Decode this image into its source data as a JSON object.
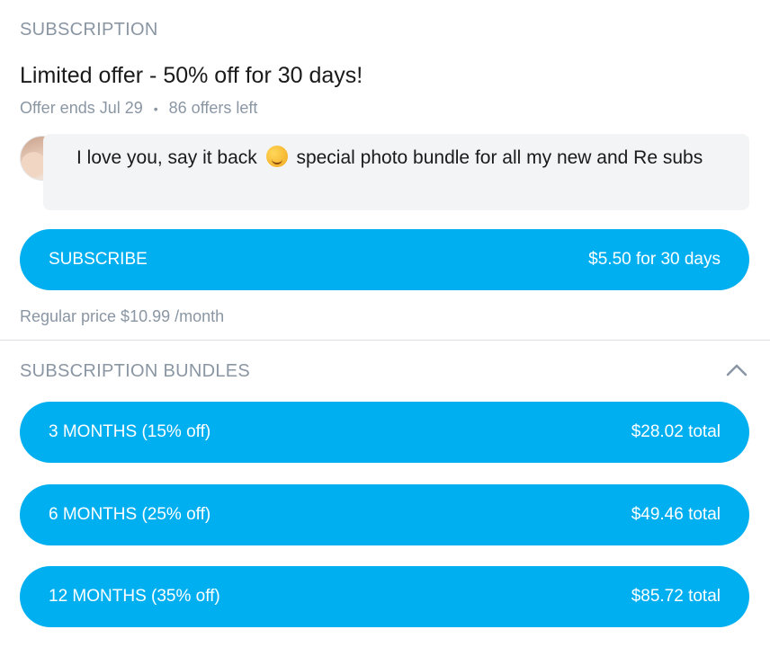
{
  "subscription": {
    "section_label": "SUBSCRIPTION",
    "offer_title": "Limited offer - 50% off for 30 days!",
    "offer_ends": "Offer ends Jul 29",
    "separator": "•",
    "offers_left": "86 offers left",
    "message_before_emoji": "I love you, say it back",
    "message_emoji": "smiling-face-with-tongue",
    "message_after_emoji": "special photo bundle for all my new and Re subs",
    "subscribe_label": "SUBSCRIBE",
    "subscribe_price": "$5.50 for 30 days",
    "regular_price": "Regular price $10.99 /month"
  },
  "bundles": {
    "section_label": "SUBSCRIPTION BUNDLES",
    "toggle_icon": "chevron-up-icon",
    "items": [
      {
        "label": "3 MONTHS (15% off)",
        "price": "$28.02 total"
      },
      {
        "label": "6 MONTHS (25% off)",
        "price": "$49.46 total"
      },
      {
        "label": "12 MONTHS (35% off)",
        "price": "$85.72 total"
      }
    ]
  },
  "colors": {
    "accent": "#00aff0",
    "muted_text": "#8a96a3",
    "message_bg": "#f3f4f6"
  }
}
